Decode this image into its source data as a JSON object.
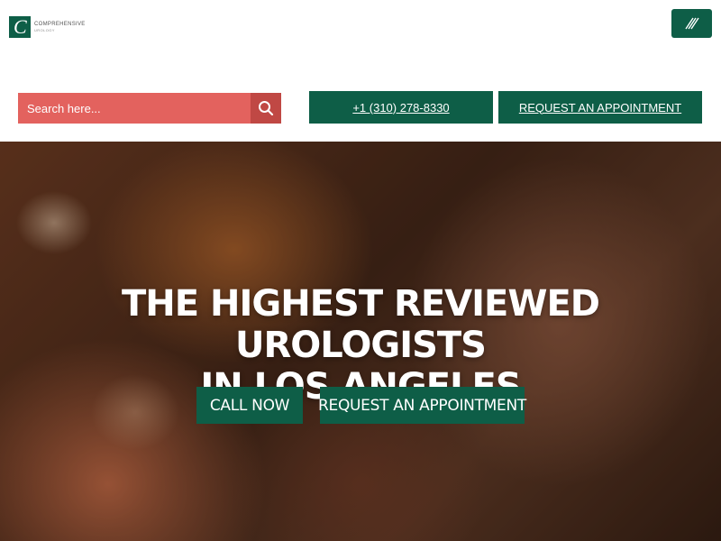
{
  "brand": {
    "name_line1": "COMPREHENSIVE",
    "name_line2": "UROLOGY",
    "logo_glyph": "C",
    "color_primary": "#0e5e47",
    "color_search": "#e3625e",
    "color_search_button": "#c04844"
  },
  "header": {
    "menu_icon": "hamburger-slashes-icon",
    "search": {
      "placeholder": "Search here...",
      "value": "",
      "icon": "search-icon"
    },
    "phone_label": "+1 (310) 278-8330",
    "appointment_label": "REQUEST AN APPOINTMENT"
  },
  "hero": {
    "title_line1": "THE HIGHEST REVIEWED UROLOGISTS",
    "title_line2": "IN LOS ANGELES",
    "call_label": "CALL NOW",
    "appointment_label": "REQUEST AN APPOINTMENT"
  }
}
